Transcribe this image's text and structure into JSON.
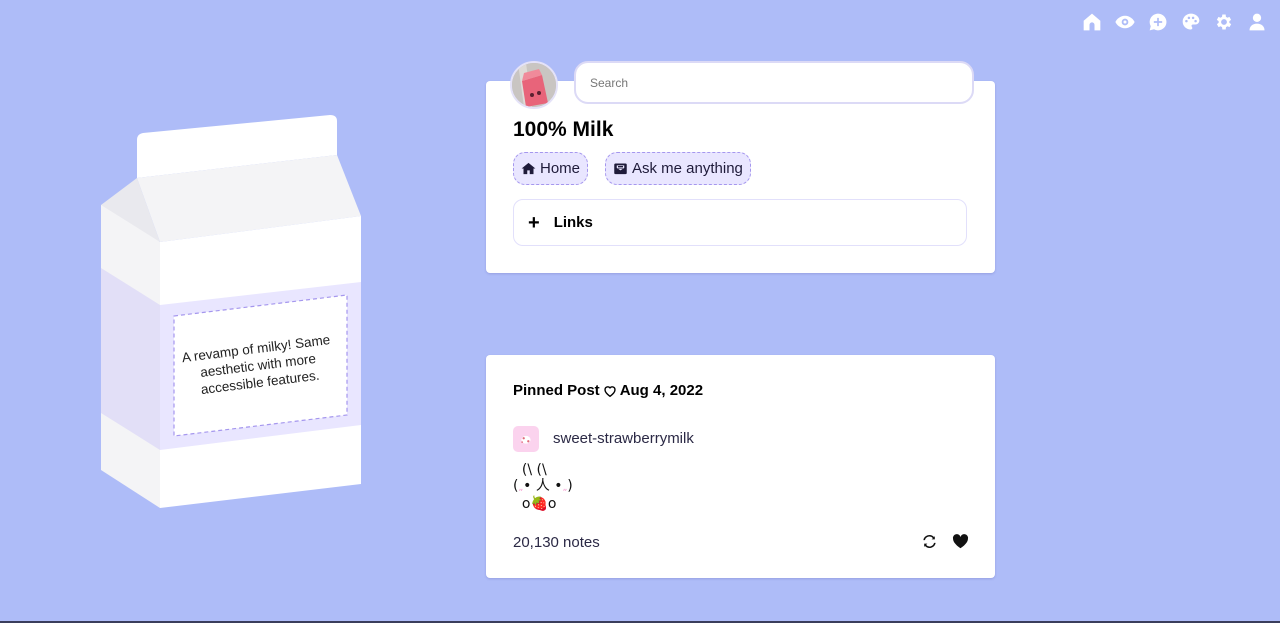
{
  "theme": {
    "background": "#aebcf8",
    "accent_pill_bg": "#e9e6ff",
    "accent_dash": "#a597ee",
    "card_bg": "#ffffff"
  },
  "topnav": {
    "items": [
      {
        "name": "home",
        "icon": "home-icon"
      },
      {
        "name": "watching",
        "icon": "eye-icon"
      },
      {
        "name": "new-post",
        "icon": "chat-plus-icon"
      },
      {
        "name": "customize",
        "icon": "palette-icon"
      },
      {
        "name": "settings",
        "icon": "gear-icon"
      },
      {
        "name": "account",
        "icon": "user-icon"
      }
    ]
  },
  "carton": {
    "description": "A revamp of milky! Same aesthetic with more accessible features."
  },
  "header": {
    "avatar_alt": "strawberry milk carton avatar",
    "search_placeholder": "Search",
    "search_value": "",
    "title": "100% Milk",
    "nav_pills": [
      {
        "label": "Home",
        "icon": "home-icon"
      },
      {
        "label": "Ask me anything",
        "icon": "envelope-open-icon"
      }
    ],
    "links_label": "Links",
    "links_icon": "plus-icon"
  },
  "post": {
    "pinned_label": "Pinned Post",
    "pinned_icon": "heart-outline-icon",
    "date": "Aug 4, 2022",
    "author": "sweet-strawberrymilk",
    "kaomoji": {
      "line1": "  (\\ (\\",
      "line2_left": "(",
      "line2_blush": "„",
      "line2_mid": "• 人 •",
      "line2_right": ")",
      "line3_left": "  o",
      "line3_berry": "🍓",
      "line3_right": "o"
    },
    "notes": "20,130 notes",
    "actions": [
      {
        "name": "reblog",
        "icon": "reblog-icon"
      },
      {
        "name": "like",
        "icon": "heart-icon"
      }
    ]
  }
}
